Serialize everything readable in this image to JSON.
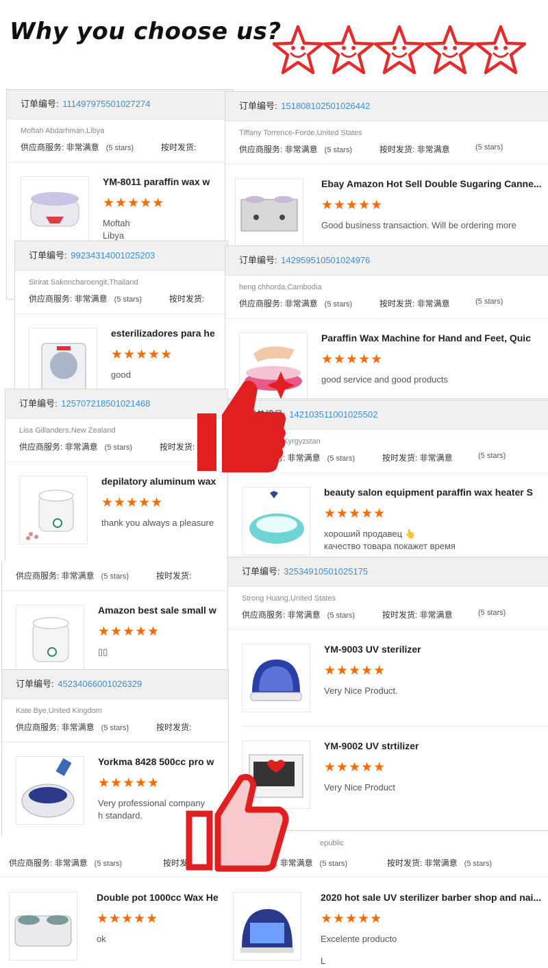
{
  "header": {
    "title": "Why you choose us?"
  },
  "labels": {
    "order_no": "订单编号:",
    "service": "供应商服务: 非常满意",
    "stars": "(5 stars)",
    "on_time": "按时发货: 非常满意",
    "on_time_trunc": "按时发货:",
    "rating_stars": "★★★★★"
  },
  "cards": {
    "c1": {
      "order": "111497975501027274",
      "buyer": "Moftah Abdarhman,Libya",
      "product": "YM-8011 paraffin wax w",
      "review": "Moftah",
      "review2": "Libya"
    },
    "c2": {
      "order": "151808102501026442",
      "buyer": "Tiffany Torrence-Forde,United States",
      "product": "Ebay Amazon Hot Sell Double Sugaring Canne...",
      "review": "Good business transaction. Will be ordering more"
    },
    "c3": {
      "order": "99234314001025203",
      "buyer": "Sirirat Sakoncharoengit,Thailand",
      "product": "esterilizadores para he",
      "review": "good"
    },
    "c4": {
      "order": "142959510501024976",
      "buyer": "heng chhorda,Cambodia",
      "product": "Paraffin Wax Machine for Hand and Feet, Quic",
      "review": "good service and good products"
    },
    "c5": {
      "order": "125707218501021468",
      "buyer": "Lisa Gillanders,New Zealand",
      "product": "depilatory aluminum wax",
      "review": "thank you always a pleasure"
    },
    "c6": {
      "order": "142103511001025502",
      "buyer": "lov,Kyrgyzstan",
      "product": "beauty salon equipment paraffin wax heater S",
      "review": "хороший продавец 👆",
      "review2": "качество товара покажет время"
    },
    "c7": {
      "product": "Amazon best sale small w",
      "review": "▯▯"
    },
    "c8": {
      "order": "32534910501025175",
      "buyer": "Strong Huang,United States",
      "product": "YM-9003 UV sterilizer",
      "review": "Very Nice Product.",
      "product2": "YM-9002 UV strtilizer",
      "review2": "Very Nice Product"
    },
    "c9": {
      "order": "45234066001026329",
      "buyer": "Kate Bye,United Kingdom",
      "product": "Yorkma 8428 500cc pro w",
      "review": "Very professional company",
      "review2": "h standard."
    },
    "c10": {
      "buyer": "epublic",
      "product": "Double pot 1000cc Wax He",
      "review": "ok"
    },
    "c11": {
      "product": "2020 hot sale UV sterilizer barber shop and nai...",
      "review": "Excelente producto",
      "review2": "L"
    }
  },
  "colors": {
    "accent_star": "#ff6a00",
    "order_link": "#3a8ed6",
    "thumb_icon": "#e02020",
    "header_bg": "#f0f0f0"
  },
  "icons": [
    "smiling-star-icon",
    "thumbs-up-icon",
    "heart-icon"
  ]
}
